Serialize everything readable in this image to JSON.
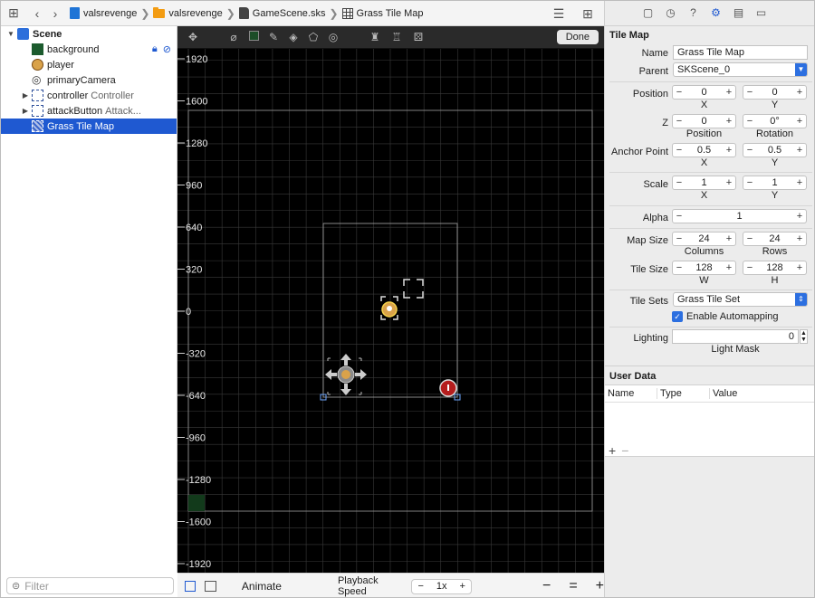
{
  "jumpbar": {
    "crumbs": [
      "valsrevenge",
      "valsrevenge",
      "GameScene.sks",
      "Grass Tile Map"
    ]
  },
  "outline": {
    "items": [
      {
        "label": "Scene",
        "sub": ""
      },
      {
        "label": "background",
        "sub": ""
      },
      {
        "label": "player",
        "sub": ""
      },
      {
        "label": "primaryCamera",
        "sub": ""
      },
      {
        "label": "controller",
        "sub": "Controller"
      },
      {
        "label": "attackButton",
        "sub": "Attack..."
      },
      {
        "label": "Grass Tile Map",
        "sub": ""
      }
    ],
    "filter_placeholder": "Filter"
  },
  "editor": {
    "done_label": "Done",
    "y_ticks": [
      "1920",
      "1600",
      "1280",
      "960",
      "640",
      "320",
      "0",
      "-320",
      "-640",
      "-960",
      "-1280",
      "-1600",
      "-1920"
    ]
  },
  "bottombar": {
    "animate_label": "Animate",
    "playback_label": "Playback Speed",
    "playback_value": "1x",
    "minus": "−",
    "plus": "+",
    "equals": "="
  },
  "inspector": {
    "section_title": "Tile Map",
    "name_label": "Name",
    "name_value": "Grass Tile Map",
    "parent_label": "Parent",
    "parent_value": "SKScene_0",
    "position_label": "Position",
    "position_x": "0",
    "position_y": "0",
    "x_label": "X",
    "y_label": "Y",
    "z_label": "Z",
    "z_position": "0",
    "z_rotation": "0°",
    "z_position_label": "Position",
    "rotation_label": "Rotation",
    "anchor_label": "Anchor Point",
    "anchor_x": "0.5",
    "anchor_y": "0.5",
    "scale_label": "Scale",
    "scale_x": "1",
    "scale_y": "1",
    "alpha_label": "Alpha",
    "alpha_value": "1",
    "mapsize_label": "Map Size",
    "mapsize_columns": "24",
    "mapsize_rows": "24",
    "columns_label": "Columns",
    "rows_label": "Rows",
    "tilesize_label": "Tile Size",
    "tilesize_w": "128",
    "tilesize_h": "128",
    "w_label": "W",
    "h_label": "H",
    "tilesets_label": "Tile Sets",
    "tilesets_value": "Grass Tile Set",
    "automap_label": "Enable Automapping",
    "lighting_label": "Lighting",
    "lighting_value": "0",
    "lightmask_label": "Light Mask",
    "userdata_title": "User Data",
    "ud_name": "Name",
    "ud_type": "Type",
    "ud_value": "Value",
    "ud_add": "+",
    "ud_remove": "−"
  }
}
